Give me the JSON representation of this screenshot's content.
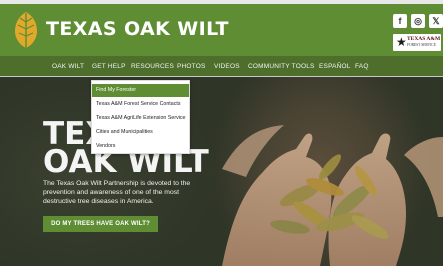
{
  "brand": {
    "title": "TEXAS OAK WILT",
    "logo_icon": "oak-leaf-icon"
  },
  "social": [
    {
      "name": "facebook-icon",
      "glyph": "f"
    },
    {
      "name": "instagram-icon",
      "glyph": "◎"
    },
    {
      "name": "twitter-icon",
      "glyph": "𝕏"
    }
  ],
  "agency": {
    "star_glyph": "★",
    "name": "TEXAS A&M",
    "subtitle": "FOREST SERVICE"
  },
  "nav": {
    "items": [
      "OAK WILT",
      "GET HELP",
      "RESOURCES",
      "PHOTOS",
      "VIDEOS",
      "COMMUNITY TOOLS",
      "ESPAÑOL",
      "FAQ"
    ]
  },
  "dropdown": {
    "items": [
      "Find My Forester",
      "Texas A&M Forest Service Contacts",
      "Texas A&M AgriLife Extension Service",
      "Cities and Municipalities",
      "Vendors"
    ],
    "active_index": 0
  },
  "hero": {
    "title_line1": "TEXAS",
    "title_line2": "OAK WILT",
    "description": "The Texas Oak Wilt Partnership is devoted to the prevention and awareness of one of the most destructive tree diseases in America.",
    "cta_label": "DO MY TREES HAVE OAK WILT?"
  },
  "colors": {
    "brand_green": "#5e8d33",
    "nav_green": "#4d6f2b"
  }
}
